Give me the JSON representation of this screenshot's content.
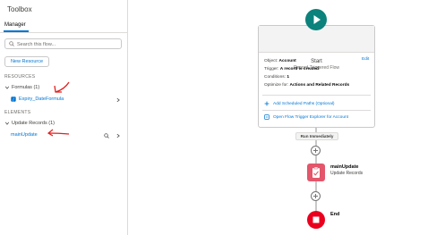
{
  "toolbox": {
    "title": "Toolbox",
    "tab_label": "Manager",
    "search_placeholder": "Search this flow...",
    "new_resource_label": "New Resource",
    "resources_label": "RESOURCES",
    "formulas_group": "Formulas (1)",
    "formula_item": "Expiry_DateFormula",
    "elements_label": "ELEMENTS",
    "update_group": "Update Records (1)",
    "update_item": "mainUpdate"
  },
  "start_card": {
    "title": "Start",
    "subtitle": "Record-Triggered Flow",
    "object_label": "Object:",
    "object_value": "Account",
    "edit_label": "Edit",
    "trigger_label": "Trigger:",
    "trigger_value": "A record is created",
    "conditions_label": "Conditions:",
    "conditions_value": "1",
    "optimize_label": "Optimize for:",
    "optimize_value": "Actions and Related Records",
    "add_paths_label": "Add Scheduled Paths (Optional)",
    "explorer_label": "Open Flow Trigger Explorer for Account"
  },
  "canvas": {
    "run_label": "Run Immediately",
    "update_node_name": "mainUpdate",
    "update_node_type": "Update Records",
    "end_label": "End"
  },
  "colors": {
    "accent": "#0176d3",
    "start_green": "#0b827c",
    "update_pink": "#e3566b",
    "end_red": "#ea001e",
    "annotation_red": "#e02020"
  }
}
